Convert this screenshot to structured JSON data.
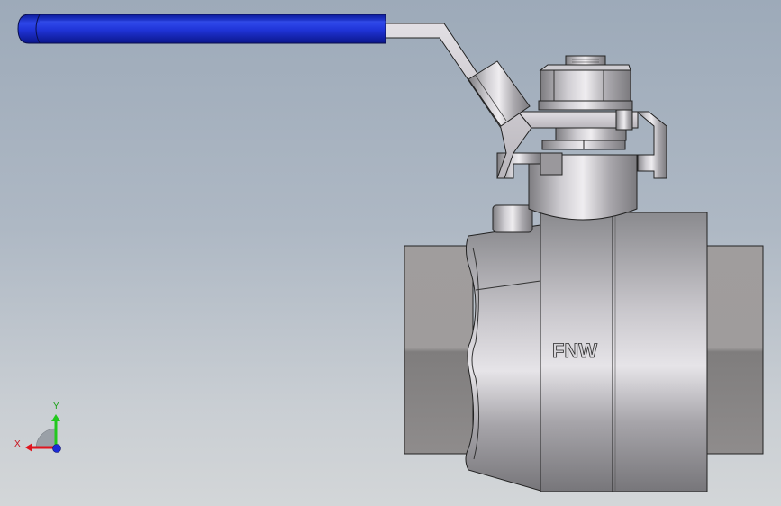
{
  "viewport": {
    "model_marking": "FNW",
    "triad": {
      "x_label": "X",
      "y_label": "Y",
      "x_color": "#e0141e",
      "y_color": "#22c81e",
      "z_color": "#1a2ad8"
    }
  },
  "colors": {
    "handle_grip": "#1f33d6",
    "background_top": "#9daab9",
    "background_bottom": "#d3d6d8"
  },
  "icons": [
    "coordinate-triad-icon"
  ]
}
